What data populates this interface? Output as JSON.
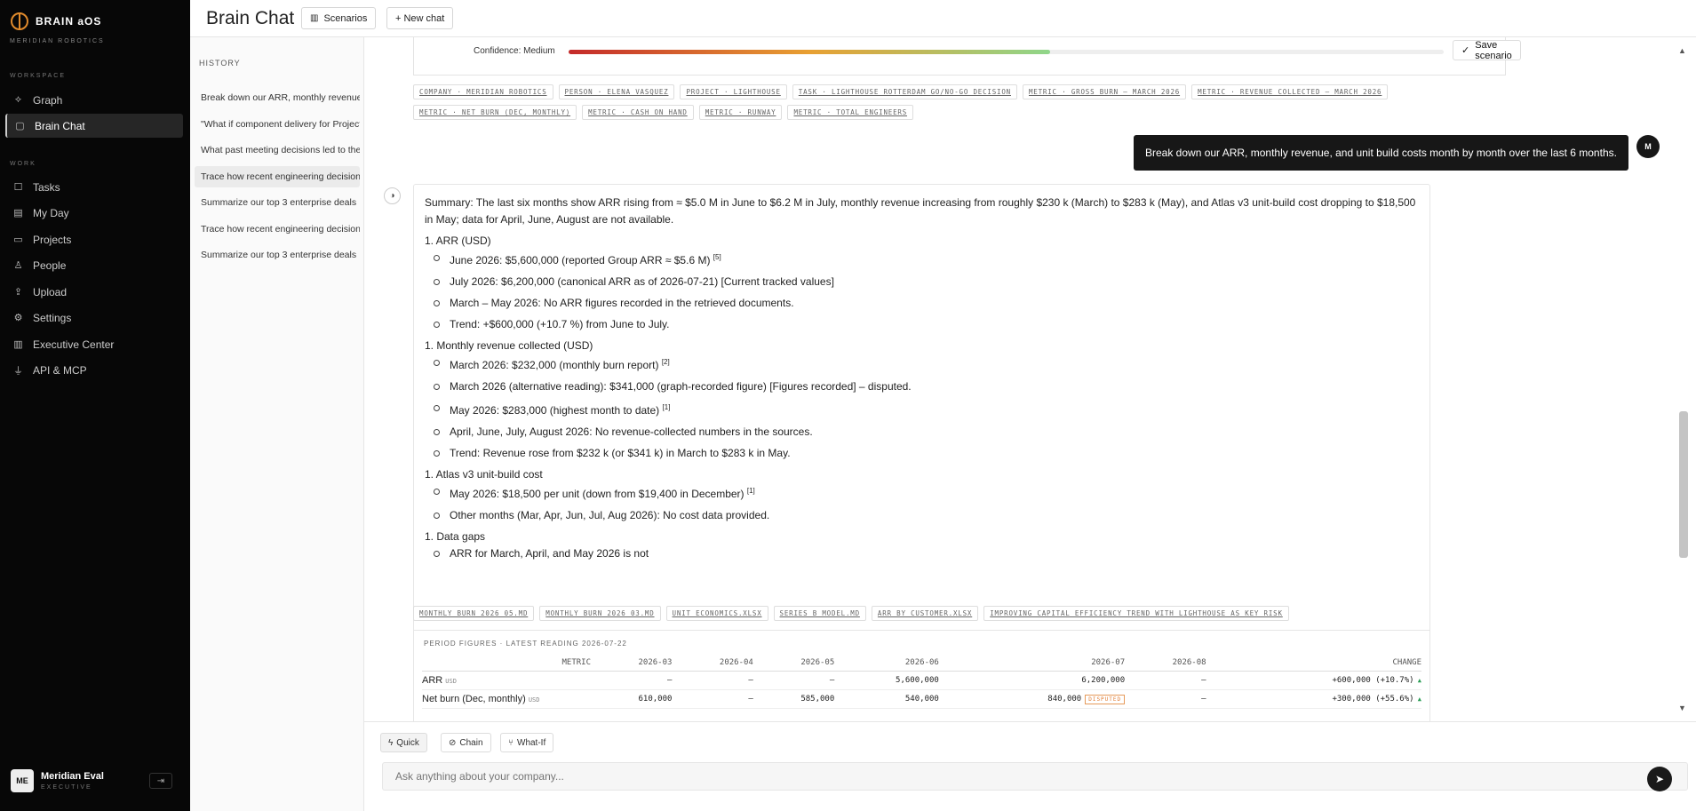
{
  "app": {
    "name": "BRAIN aOS",
    "org": "MERIDIAN ROBOTICS"
  },
  "sidebar": {
    "sections": [
      "WORKSPACE",
      "WORK"
    ],
    "items": [
      {
        "label": "Graph",
        "icon": "graph-icon"
      },
      {
        "label": "Brain Chat",
        "icon": "chat-icon"
      },
      {
        "label": "Tasks",
        "icon": "tasks-icon"
      },
      {
        "label": "My Day",
        "icon": "calendar-icon"
      },
      {
        "label": "Projects",
        "icon": "folder-icon"
      },
      {
        "label": "People",
        "icon": "people-icon"
      },
      {
        "label": "Upload",
        "icon": "upload-icon"
      },
      {
        "label": "Settings",
        "icon": "gear-icon"
      },
      {
        "label": "Executive Center",
        "icon": "bar-chart-icon"
      },
      {
        "label": "API & MCP",
        "icon": "plug-icon"
      }
    ],
    "user": {
      "initials": "ME",
      "name": "Meridian Eval",
      "role": "EXECUTIVE"
    }
  },
  "topbar": {
    "title": "Brain Chat",
    "scenarios": "Scenarios",
    "new_chat": "+ New chat"
  },
  "history": {
    "title": "HISTORY",
    "items": [
      "Break down our ARR, monthly revenue, and unit build costs month by month over the last 6 months.",
      "\"What if component delivery for Project Lighthouse slips\"",
      "What past meeting decisions led to the current situation",
      "Trace how recent engineering decisions affected burn",
      "Summarize our top 3 enterprise deals",
      "Trace how recent engineering decisions affected burn",
      "Summarize our top 3 enterprise deals"
    ]
  },
  "scenario": {
    "confidence_label": "Confidence: Medium",
    "confidence_value": 0.55,
    "save": "Save scenario"
  },
  "entity_tags": [
    "COMPANY · MERIDIAN ROBOTICS",
    "PERSON · ELENA VASQUEZ",
    "PROJECT · LIGHTHOUSE",
    "TASK · LIGHTHOUSE ROTTERDAM GO/NO-GO DECISION",
    "METRIC · GROSS BURN — MARCH 2026",
    "METRIC · REVENUE COLLECTED — MARCH 2026",
    "METRIC · NET BURN (DEC, MONTHLY)",
    "METRIC · CASH ON HAND",
    "METRIC · RUNWAY",
    "METRIC · TOTAL ENGINEERS"
  ],
  "user_message": {
    "text": "Break down our ARR, monthly revenue, and unit build costs month by month over the last 6 months.",
    "avatar": "M"
  },
  "answer": {
    "summary_label": "Summary:",
    "summary_text": " The last six months show ARR rising from ≈ $5.0 M in June to $6.2 M in July, monthly revenue increasing from roughly $230 k (March) to $283 k (May), and Atlas v3 unit‑build cost dropping to $18,500 in May; data for April, June, August are not available.",
    "sections": [
      {
        "heading": "1. ARR (USD)",
        "items": [
          {
            "b": "June 2026:",
            "t": " $5,600,000 (reported Group ARR ≈ $5.6 M) ",
            "sup": "[5]"
          },
          {
            "b": "July 2026:",
            "t": " $6,200,000 (canonical ARR as of 2026‑07‑21) [Current tracked values]",
            "sup": ""
          },
          {
            "b": "March – May 2026:",
            "t": " No ARR figures recorded in the retrieved documents.",
            "sup": ""
          },
          {
            "b": "Trend:",
            "t": " +$600,000 (+10.7 %) from June to July.",
            "sup": ""
          }
        ]
      },
      {
        "heading": "1. Monthly revenue collected (USD)",
        "items": [
          {
            "b": "March 2026:",
            "t": " $232,000 (monthly burn report) ",
            "sup": "[2]"
          },
          {
            "b": "March 2026 (alternative reading):",
            "t": " $341,000 (graph‑recorded figure) [Figures recorded] – disputed.",
            "sup": ""
          },
          {
            "b": "May 2026:",
            "t": " $283,000 (highest month to date) ",
            "sup": "[1]"
          },
          {
            "b": "April, June, July, August 2026:",
            "t": " No revenue‑collected numbers in the sources.",
            "sup": ""
          },
          {
            "b": "Trend:",
            "t": " Revenue rose from $232 k (or $341 k) in March to $283 k in May.",
            "sup": ""
          }
        ]
      },
      {
        "heading": "1. Atlas v3 unit‑build cost",
        "items": [
          {
            "b": "May 2026:",
            "t": " $18,500 per unit (down from $19,400 in December) ",
            "sup": "[1]"
          },
          {
            "b": "Other months (Mar, Apr, Jun, Jul, Aug 2026):",
            "t": " No cost data provided.",
            "sup": ""
          }
        ]
      },
      {
        "heading": "1. Data gaps",
        "items": [
          {
            "b": "",
            "t": "ARR for March, April, and May 2026 is not",
            "sup": ""
          }
        ]
      }
    ]
  },
  "source_tags": [
    "MONTHLY_BURN_2026_05.MD",
    "MONTHLY_BURN_2026_03.MD",
    "UNIT_ECONOMICS.XLSX",
    "SERIES_B_MODEL.MD",
    "ARR_BY_CUSTOMER.XLSX",
    "IMPROVING CAPITAL EFFICIENCY TREND WITH LIGHTHOUSE AS KEY RISK"
  ],
  "period_table": {
    "title": "PERIOD FIGURES · LATEST READING 2026-07-22",
    "columns": [
      "METRIC",
      "2026-03",
      "2026-04",
      "2026-05",
      "2026-06",
      "2026-07",
      "2026-08",
      "CHANGE"
    ],
    "rows": [
      {
        "metric": "ARR",
        "unit": "USD",
        "values": [
          "—",
          "—",
          "—",
          "5,600,000",
          "6,200,000",
          "—"
        ],
        "disputed": "",
        "change": "+600,000 (+10.7%)"
      },
      {
        "metric": "Net burn (Dec, monthly)",
        "unit": "USD",
        "values": [
          "610,000",
          "—",
          "585,000",
          "540,000",
          "840,000",
          "—"
        ],
        "disputed": "DISPUTED",
        "change": "+300,000 (+55.6%)"
      }
    ]
  },
  "composer": {
    "modes": [
      "Quick",
      "Chain",
      "What-If"
    ],
    "placeholder": "Ask anything about your company..."
  }
}
